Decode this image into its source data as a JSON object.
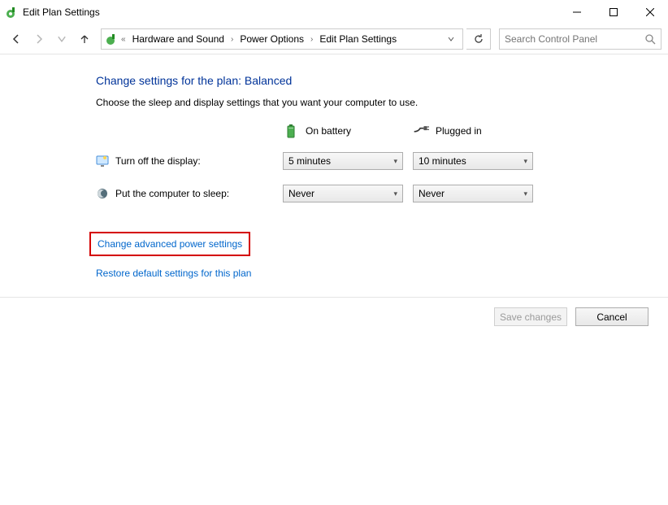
{
  "window": {
    "title": "Edit Plan Settings"
  },
  "breadcrumb": {
    "prefix": "«",
    "items": [
      "Hardware and Sound",
      "Power Options",
      "Edit Plan Settings"
    ]
  },
  "search": {
    "placeholder": "Search Control Panel"
  },
  "page": {
    "heading": "Change settings for the plan: Balanced",
    "subtext": "Choose the sleep and display settings that you want your computer to use.",
    "columns": {
      "battery": "On battery",
      "plugged": "Plugged in"
    },
    "rows": {
      "display": {
        "label": "Turn off the display:",
        "battery_value": "5 minutes",
        "plugged_value": "10 minutes"
      },
      "sleep": {
        "label": "Put the computer to sleep:",
        "battery_value": "Never",
        "plugged_value": "Never"
      }
    },
    "links": {
      "advanced": "Change advanced power settings",
      "restore": "Restore default settings for this plan"
    }
  },
  "footer": {
    "save": "Save changes",
    "cancel": "Cancel"
  }
}
